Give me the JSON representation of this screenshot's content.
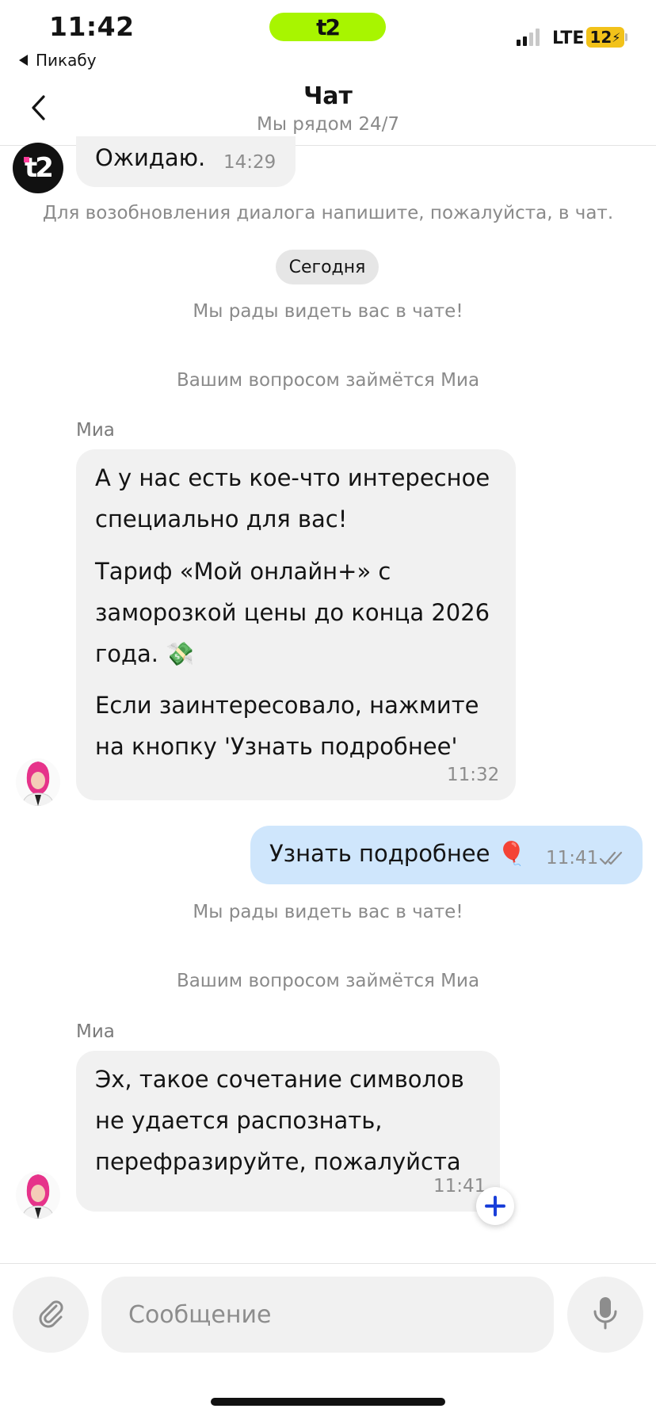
{
  "status_bar": {
    "time": "11:42",
    "carrier_logo": "t2",
    "back_app": "Пикабу",
    "network": "LTE",
    "battery": "12"
  },
  "header": {
    "title": "Чат",
    "subtitle": "Мы рядом 24/7",
    "back_icon": "chevron-left-icon"
  },
  "messages": {
    "bot_logo": "t2",
    "prev_message": {
      "text": "Ожидаю.",
      "time": "14:29"
    },
    "resume_hint": "Для возобновления диалога напишите, пожалуйста, в чат.",
    "date_separator": "Сегодня",
    "welcome_1": "Мы рады видеть вас в чате!",
    "assign_1": "Вашим вопросом займётся Миа",
    "sender_1": "Миа",
    "offer": {
      "p1": "А у нас есть кое-что интересное специально для вас!",
      "p2": "Тариф «Мой онлайн+» с заморозкой цены до конца 2026 года. 💸",
      "p3": " Если заинтересовало, нажмите на кнопку 'Узнать подробнее'",
      "time": "11:32"
    },
    "user_reply": {
      "text": "Узнать подробнее 🎈",
      "time": "11:41"
    },
    "welcome_2": "Мы рады видеть вас в чате!",
    "assign_2": "Вашим вопросом займётся Миа",
    "sender_2": "Миа",
    "error_reply": {
      "text": "Эх, такое сочетание символов не удается распознать, перефразируйте, пожалуйста",
      "time": "11:41"
    }
  },
  "composer": {
    "placeholder": "Сообщение",
    "attach_icon": "paperclip-icon",
    "mic_icon": "microphone-icon"
  },
  "colors": {
    "brand_green": "#a8f500",
    "bubble_incoming": "#f1f1f1",
    "bubble_outgoing": "#cfe6fc",
    "plus_blue": "#1a3fd9",
    "battery": "#f2c21a"
  }
}
